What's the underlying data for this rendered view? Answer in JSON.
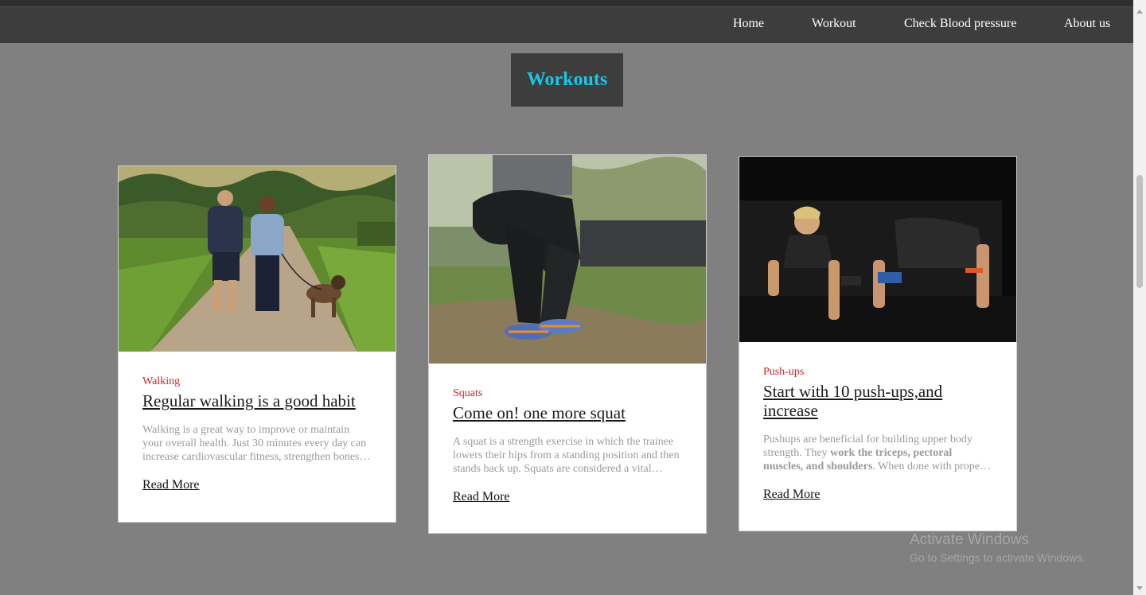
{
  "nav": {
    "items": [
      {
        "label": "Home"
      },
      {
        "label": "Workout"
      },
      {
        "label": "Check Blood pressure"
      },
      {
        "label": "About us"
      }
    ]
  },
  "page": {
    "title": "Workouts"
  },
  "cards": [
    {
      "category": "Walking",
      "title": "Regular walking is a good habit",
      "text": "Walking is a great way to improve or maintain your overall health. Just 30 minutes every day can increase cardiovascular fitness, strengthen bones, reduce excess body fat",
      "read_more": "Read More",
      "image": "couple-walking-dog-photo"
    },
    {
      "category": "Squats",
      "title": "Come on! one more squat",
      "text": "A squat is a strength exercise in which the trainee lowers their hips from a standing position and then stands back up. Squats are considered a vital exercise",
      "read_more": "Read More",
      "image": "person-squatting-photo"
    },
    {
      "category": "Push-ups",
      "title": "Start with 10 push-ups,and increase",
      "text_before": "Pushups are beneficial for building upper body strength. They ",
      "text_bold": "work the triceps, pectoral muscles, and shoulders",
      "text_after": ". When done with proper form, they can also strengthen the lower back",
      "read_more": "Read More",
      "image": "two-people-pushups-photo"
    }
  ],
  "watermark": {
    "title": "Activate Windows",
    "subtitle": "Go to Settings to activate Windows."
  },
  "colors": {
    "background": "#808080",
    "navbar": "#3d3d3d",
    "title_text": "#17c8e6",
    "category": "#d0202a"
  }
}
